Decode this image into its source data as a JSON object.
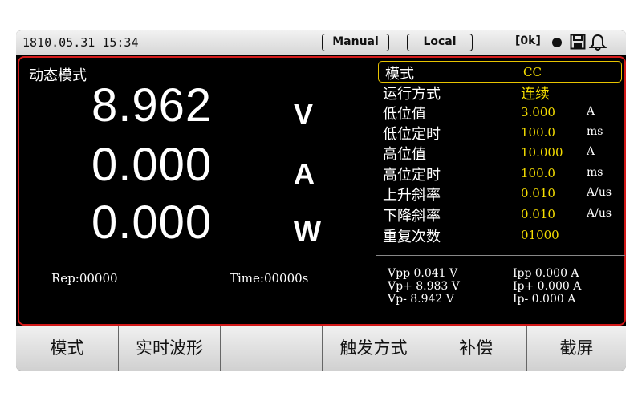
{
  "status_bar": {
    "datetime": "1810.05.31 15:34",
    "manual_label": "Manual",
    "local_label": "Local",
    "ok_label": "[0k]"
  },
  "readout": {
    "mode_title": "动态模式",
    "voltage": "8.962",
    "voltage_unit": "V",
    "current": "0.000",
    "current_unit": "A",
    "power": "0.000",
    "power_unit": "W",
    "rep": "Rep:00000",
    "time": "Time:00000s"
  },
  "params": [
    {
      "label": "模式",
      "value": "CC",
      "unit": ""
    },
    {
      "label": "运行方式",
      "value": "连续",
      "unit": ""
    },
    {
      "label": "低位值",
      "value": "3.000",
      "unit": "A"
    },
    {
      "label": "低位定时",
      "value": "100.0",
      "unit": "ms"
    },
    {
      "label": "高位值",
      "value": "10.000",
      "unit": "A"
    },
    {
      "label": "高位定时",
      "value": "100.0",
      "unit": "ms"
    },
    {
      "label": "上升斜率",
      "value": "0.010",
      "unit": "A/us"
    },
    {
      "label": "下降斜率",
      "value": "0.010",
      "unit": "A/us"
    },
    {
      "label": "重复次数",
      "value": "01000",
      "unit": ""
    }
  ],
  "measurements": {
    "vpp": "Vpp 0.041 V",
    "vp_plus": "Vp+ 8.983 V",
    "vp_minus": "Vp- 8.942 V",
    "ipp": "Ipp 0.000 A",
    "ip_plus": "Ip+ 0.000 A",
    "ip_minus": "Ip- 0.000 A"
  },
  "function_keys": [
    "模式",
    "实时波形",
    "",
    "触发方式",
    "补偿",
    "截屏"
  ],
  "colors": {
    "frame_border": "#d21919",
    "value_yellow": "#f5dd00",
    "selection_border": "#e8c400"
  },
  "icons": [
    "record-dot-icon",
    "save-icon",
    "bell-icon"
  ]
}
